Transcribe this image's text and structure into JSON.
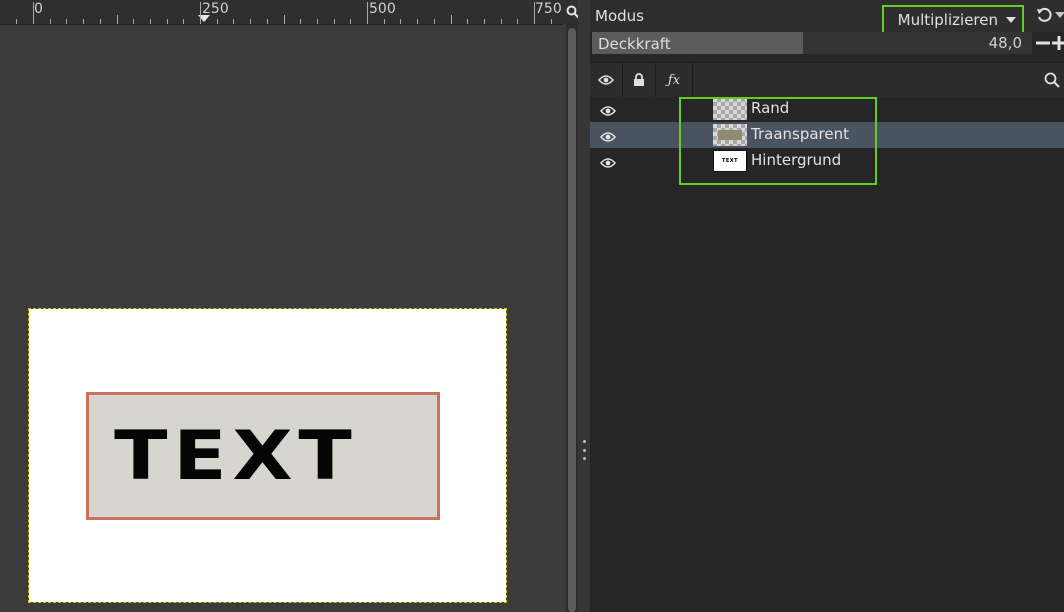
{
  "ruler": {
    "labels": [
      {
        "text": "0"
      },
      {
        "text": "250"
      },
      {
        "text": "500"
      },
      {
        "text": "750"
      }
    ]
  },
  "canvas": {
    "text": "TEXT",
    "colors": {
      "box_fill": "#d6d6cf",
      "box_border": "#c8735f",
      "text": "#050505",
      "background": "#ffffff"
    }
  },
  "dock": {
    "mode_label": "Modus",
    "mode_value": "Multiplizieren",
    "opacity_label": "Deckkraft",
    "opacity_value": "48,0",
    "opacity_fraction": 0.48,
    "header_icons": [
      "eye-icon",
      "lock-icon",
      "fx-icon",
      "search-icon"
    ],
    "layers": [
      {
        "name": "Rand",
        "thumb": "checkerboard",
        "selected": false,
        "visible": true
      },
      {
        "name": "Traansparent",
        "thumb": "checkerboard-with-box",
        "selected": true,
        "visible": true
      },
      {
        "name": "Hintergrund",
        "thumb": "text-preview",
        "thumb_text": "TEXT",
        "selected": false,
        "visible": true
      }
    ]
  },
  "colors": {
    "highlight": "#66cc22",
    "selected_row": "#4a5360"
  }
}
